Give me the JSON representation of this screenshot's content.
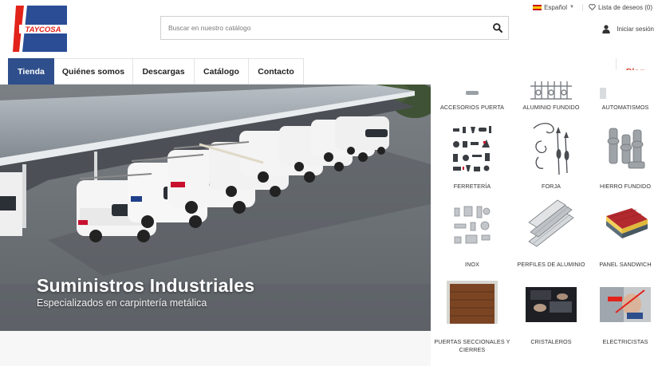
{
  "header": {
    "logo_text": "TAYCOSA",
    "search": {
      "placeholder": "Buscar en nuestro catálogo",
      "value": ""
    },
    "language": "Español",
    "wishlist": "Lista de deseos (0)",
    "login": "Iniciar sesión"
  },
  "nav": {
    "items": [
      {
        "label": "Tienda",
        "active": true
      },
      {
        "label": "Quiénes somos",
        "active": false
      },
      {
        "label": "Descargas",
        "active": false
      },
      {
        "label": "Catálogo",
        "active": false
      },
      {
        "label": "Contacto",
        "active": false
      }
    ],
    "blog": "Blog"
  },
  "hero": {
    "title": "Suministros Industriales",
    "subtitle": "Especializados en carpintería metálica"
  },
  "categories": [
    {
      "label": "ACCESORIOS PUERTA",
      "icon": "door-accessories-icon"
    },
    {
      "label": "ALUMINIO FUNDIDO",
      "icon": "cast-aluminum-icon"
    },
    {
      "label": "AUTOMATISMOS",
      "icon": "automation-icon"
    },
    {
      "label": "FERRETERÍA",
      "icon": "hardware-tools-icon"
    },
    {
      "label": "FORJA",
      "icon": "wrought-iron-icon"
    },
    {
      "label": "HIERRO FUNDIDO",
      "icon": "cast-iron-icon"
    },
    {
      "label": "INOX",
      "icon": "stainless-steel-icon"
    },
    {
      "label": "PERFILES DE ALUMINIO",
      "icon": "aluminum-profiles-icon"
    },
    {
      "label": "PANEL SANDWICH",
      "icon": "sandwich-panel-icon"
    },
    {
      "label": "PUERTAS SECCIONALES Y CIERRES",
      "icon": "sectional-door-icon"
    },
    {
      "label": "CRISTALEROS",
      "icon": "glaziers-icon"
    },
    {
      "label": "ELECTRICISTAS",
      "icon": "electricians-icon"
    }
  ],
  "colors": {
    "brand_blue": "#2e4f8b",
    "brand_red": "#e2231a",
    "blog_red": "#d6452f"
  }
}
